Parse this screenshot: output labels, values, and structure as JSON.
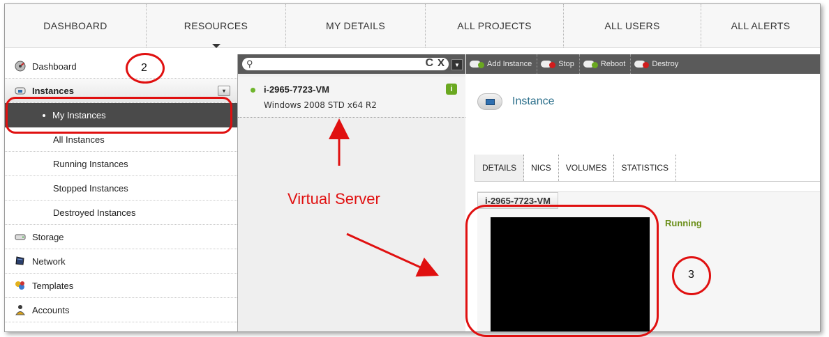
{
  "top_nav": {
    "items": [
      {
        "label": "DASHBOARD",
        "active": false
      },
      {
        "label": "RESOURCES",
        "active": true
      },
      {
        "label": "MY DETAILS",
        "active": false
      },
      {
        "label": "ALL PROJECTS",
        "active": false
      },
      {
        "label": "ALL USERS",
        "active": false
      },
      {
        "label": "ALL ALERTS",
        "active": false
      }
    ]
  },
  "sidebar": {
    "items": [
      {
        "label": "Dashboard",
        "icon": "dashboard-icon"
      },
      {
        "label": "Instances",
        "icon": "instances-icon"
      },
      {
        "label": "My Instances"
      },
      {
        "label": "All Instances"
      },
      {
        "label": "Running Instances"
      },
      {
        "label": "Stopped Instances"
      },
      {
        "label": "Destroyed Instances"
      },
      {
        "label": "Storage",
        "icon": "storage-icon"
      },
      {
        "label": "Network",
        "icon": "network-icon"
      },
      {
        "label": "Templates",
        "icon": "templates-icon"
      },
      {
        "label": "Accounts",
        "icon": "accounts-icon"
      }
    ]
  },
  "list": {
    "search_value": "",
    "items": [
      {
        "name": "i-2965-7723-VM",
        "os": "Windows 2008 STD x64 R2",
        "status_color": "#6fb52c"
      }
    ]
  },
  "toolbar": {
    "buttons": [
      {
        "label": "Add Instance",
        "badge_color": "#6aa820"
      },
      {
        "label": "Stop",
        "badge_color": "#d01c1c"
      },
      {
        "label": "Reboot",
        "badge_color": "#6aa820"
      },
      {
        "label": "Destroy",
        "badge_color": "#d01c1c"
      }
    ]
  },
  "detail": {
    "title": "Instance",
    "tabs": [
      "DETAILS",
      "NICS",
      "VOLUMES",
      "STATISTICS"
    ],
    "vm_name": "i-2965-7723-VM",
    "state": "Running"
  },
  "annotations": {
    "num_2": "2",
    "num_3": "3",
    "label": "Virtual Server"
  },
  "colors": {
    "accent_red": "#e01010",
    "running_green": "#6b8f1a"
  }
}
